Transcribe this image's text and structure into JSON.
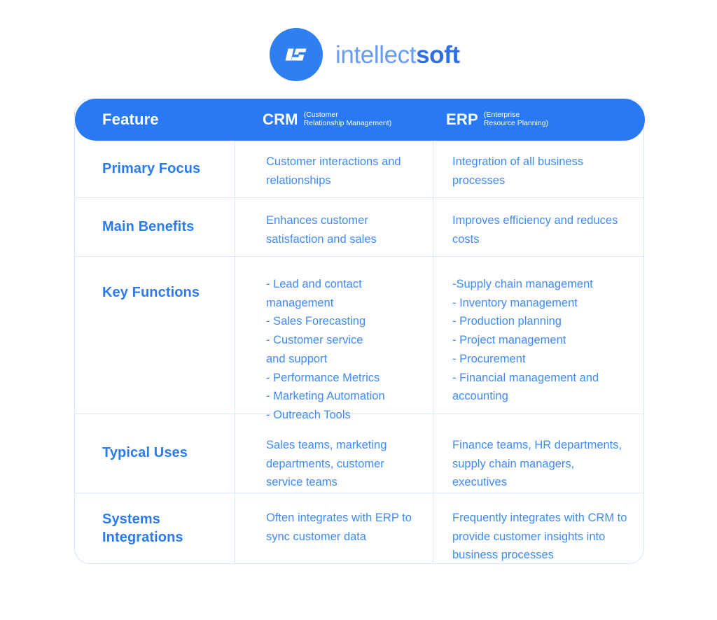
{
  "brand": {
    "logo_icon": "intellectsoft-monogram-icon",
    "name_light": "intellect",
    "name_bold": "soft",
    "circle_color": "#2f7ff0",
    "text_light_color": "#6a9bf2",
    "text_bold_color": "#2f6fe0"
  },
  "table": {
    "header_bg": "#2979f5",
    "grid_color": "#dce9fb",
    "label_color": "#2a7bf2",
    "body_color": "#3f8bf7",
    "columns": [
      {
        "title": "Feature",
        "subtitle": ""
      },
      {
        "title": "CRM",
        "subtitle": "(Customer\nRelationship Management)"
      },
      {
        "title": "ERP",
        "subtitle": "(Enterprise\nResource Planning)"
      }
    ],
    "rows": [
      {
        "label": "Primary Focus",
        "crm": "Customer interactions and relationships",
        "erp": "Integration of all business processes"
      },
      {
        "label": "Main Benefits",
        "crm": "Enhances customer satisfaction and sales",
        "erp": "Improves efficiency and reduces costs"
      },
      {
        "label": "Key Functions",
        "crm_items": [
          "- Lead and contact\n   management",
          "- Sales Forecasting",
          "- Customer service\n   and support",
          "- Performance Metrics",
          "- Marketing Automation",
          "- Outreach Tools"
        ],
        "erp_items": [
          "-Supply chain management",
          "- Inventory management",
          "- Production planning",
          "- Project management",
          "- Procurement",
          "- Financial management and\naccounting"
        ]
      },
      {
        "label": "Typical Uses",
        "crm": "Sales teams, marketing departments, customer service teams",
        "erp": "Finance teams, HR departments, supply chain managers, executives"
      },
      {
        "label": "Systems Integrations",
        "crm": "Often integrates with ERP to sync customer data",
        "erp": "Frequently integrates with CRM to provide customer insights into business processes"
      }
    ]
  }
}
